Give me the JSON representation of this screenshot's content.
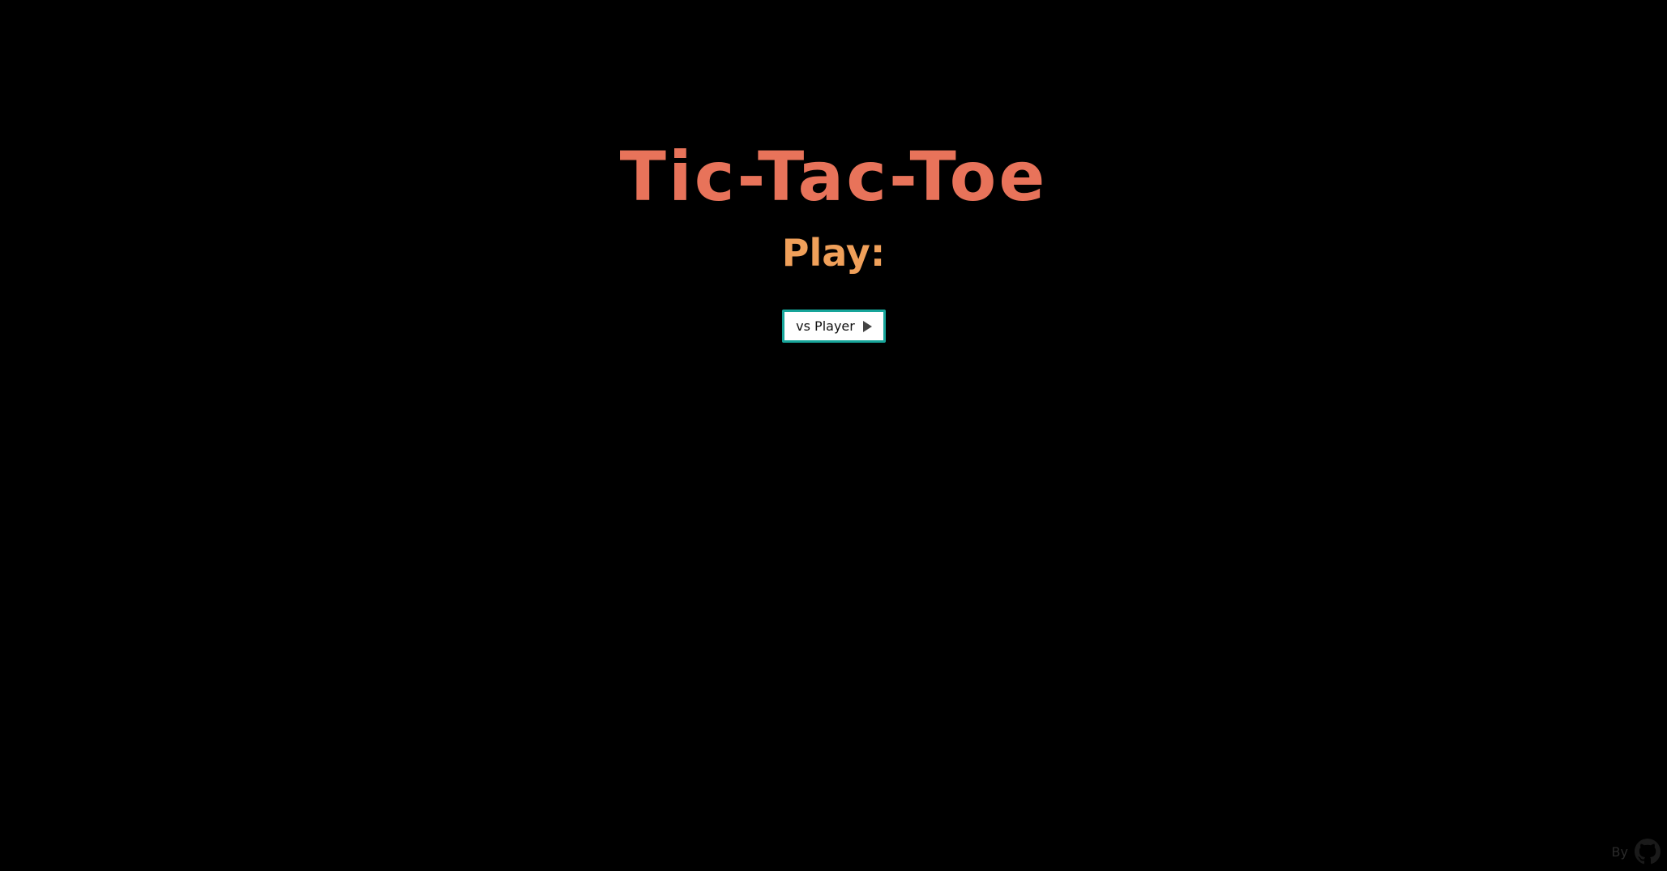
{
  "game": {
    "title": "Tic-Tac-Toe",
    "subtitle": "Play:",
    "play_button_label": "vs Player",
    "play_button_icon": "play-icon"
  },
  "footer": {
    "by_text": "By",
    "icon": "github-icon"
  },
  "colors": {
    "background": "#000000",
    "title": "#e8735a",
    "subtitle": "#f0a05a",
    "button_border": "#17a59a",
    "footer": "#2a2a2a"
  }
}
